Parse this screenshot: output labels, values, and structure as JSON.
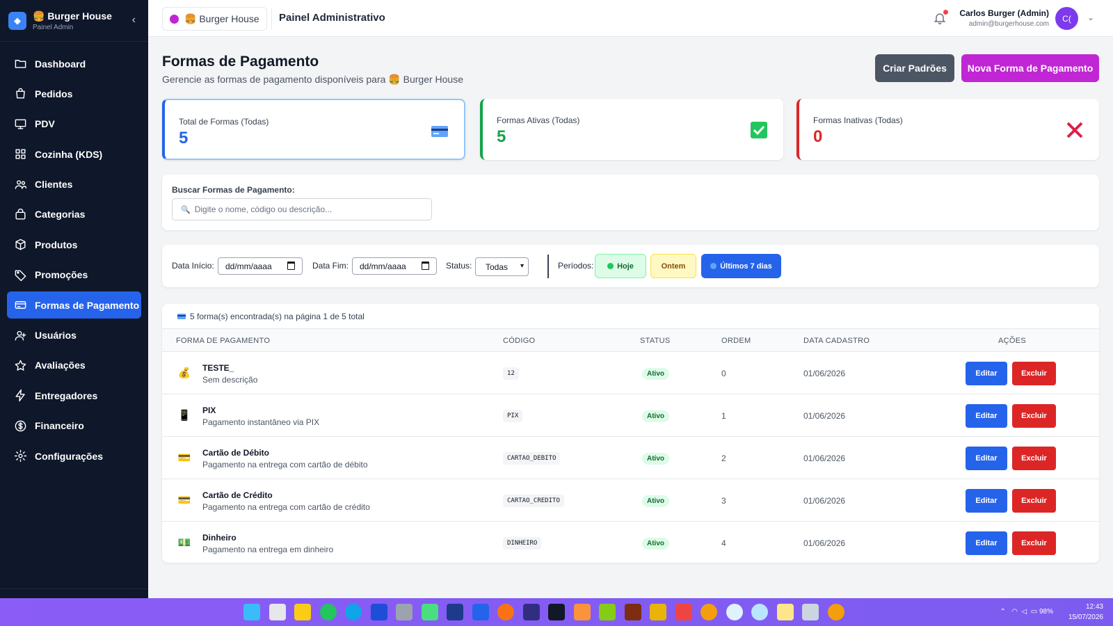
{
  "sidebar": {
    "brand_title": "🍔 Burger House",
    "brand_subtitle": "Painel Admin",
    "collapse_icon": "chevron-left-icon",
    "items": [
      {
        "label": "Dashboard",
        "icon": "folder-icon",
        "active": false
      },
      {
        "label": "Pedidos",
        "icon": "shopping-bag-icon",
        "active": false
      },
      {
        "label": "PDV",
        "icon": "monitor-icon",
        "active": false
      },
      {
        "label": "Cozinha (KDS)",
        "icon": "grid-icon",
        "active": false
      },
      {
        "label": "Clientes",
        "icon": "users-icon",
        "active": false
      },
      {
        "label": "Categorias",
        "icon": "bag-icon",
        "active": false
      },
      {
        "label": "Produtos",
        "icon": "box-icon",
        "active": false
      },
      {
        "label": "Promoções",
        "icon": "tag-icon",
        "active": false
      },
      {
        "label": "Formas de Pagamento",
        "icon": "credit-card-icon",
        "active": true
      },
      {
        "label": "Usuários",
        "icon": "user-plus-icon",
        "active": false
      },
      {
        "label": "Avaliações",
        "icon": "star-icon",
        "active": false
      },
      {
        "label": "Entregadores",
        "icon": "bolt-icon",
        "active": false
      },
      {
        "label": "Financeiro",
        "icon": "dollar-icon",
        "active": false
      },
      {
        "label": "Configurações",
        "icon": "gear-icon",
        "active": false
      }
    ]
  },
  "topbar": {
    "store_name": "🍔 Burger House",
    "title": "Painel Administrativo",
    "user_name": "Carlos Burger (Admin)",
    "user_email": "admin@burgerhouse.com",
    "avatar_initials": "C("
  },
  "page": {
    "title": "Formas de Pagamento",
    "subtitle": "Gerencie as formas de pagamento disponíveis para 🍔 Burger House",
    "btn_defaults": "Criar Padrões",
    "btn_new": "Nova Forma de Pagamento"
  },
  "stats": [
    {
      "label": "Total de Formas (Todas)",
      "value": "5",
      "color": "#2563eb",
      "icon": "credit-card-icon"
    },
    {
      "label": "Formas Ativas (Todas)",
      "value": "5",
      "color": "#16a34a",
      "icon": "check-box-icon"
    },
    {
      "label": "Formas Inativas (Todas)",
      "value": "0",
      "color": "#dc2626",
      "icon": "cross-icon"
    }
  ],
  "search": {
    "label": "Buscar Formas de Pagamento:",
    "placeholder": "Digite o nome, código ou descrição..."
  },
  "filters": {
    "start_label": "Data Início:",
    "start_value": "dd/mm/aaaa",
    "end_label": "Data Fim:",
    "end_value": "dd/mm/aaaa",
    "status_label": "Status:",
    "status_value": "Todas",
    "periods_label": "Períodos:",
    "period_today": "Hoje",
    "period_yesterday": "Ontem",
    "period_7days": "Últimos 7 dias"
  },
  "table": {
    "summary": "5 forma(s) encontrada(s) na página 1 de 5 total",
    "headers": [
      "FORMA DE PAGAMENTO",
      "CÓDIGO",
      "STATUS",
      "ORDEM",
      "DATA CADASTRO",
      "AÇÕES"
    ],
    "edit_label": "Editar",
    "delete_label": "Excluir",
    "rows": [
      {
        "icon": "💰",
        "name": "TESTE_",
        "desc": "Sem descrição",
        "code": "12",
        "status": "Ativo",
        "order": "0",
        "date": "01/06/2026"
      },
      {
        "icon": "📱",
        "name": "PIX",
        "desc": "Pagamento instantâneo via PIX",
        "code": "PIX",
        "status": "Ativo",
        "order": "1",
        "date": "01/06/2026"
      },
      {
        "icon": "💳",
        "name": "Cartão de Débito",
        "desc": "Pagamento na entrega com cartão de débito",
        "code": "CARTAO_DEBITO",
        "status": "Ativo",
        "order": "2",
        "date": "01/06/2026"
      },
      {
        "icon": "💳",
        "name": "Cartão de Crédito",
        "desc": "Pagamento na entrega com cartão de crédito",
        "code": "CARTAO_CREDITO",
        "status": "Ativo",
        "order": "3",
        "date": "01/06/2026"
      },
      {
        "icon": "💵",
        "name": "Dinheiro",
        "desc": "Pagamento na entrega em dinheiro",
        "code": "DINHEIRO",
        "status": "Ativo",
        "order": "4",
        "date": "01/06/2026"
      }
    ]
  },
  "taskbar": {
    "battery": "98%",
    "time": "12:43",
    "date": "15/07/2026"
  }
}
